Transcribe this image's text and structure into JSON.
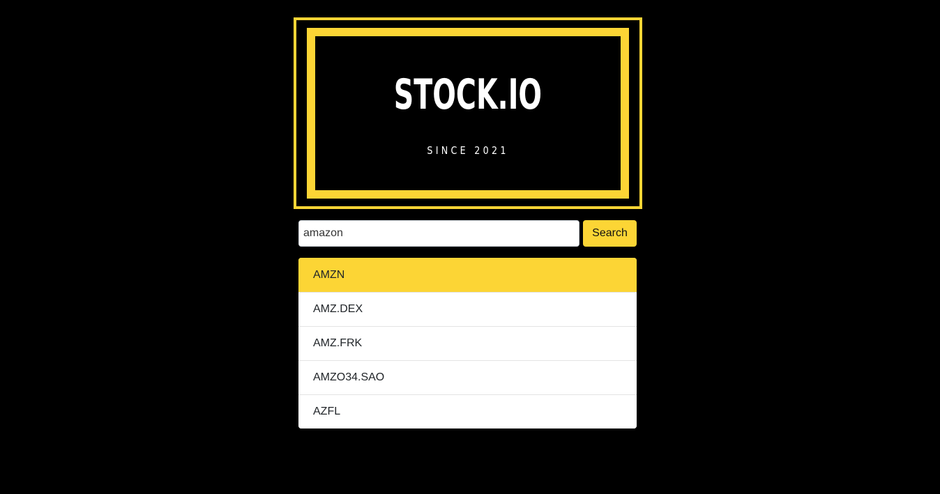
{
  "logo": {
    "title": "STOCK.IO",
    "subtitle": "SINCE 2021"
  },
  "search": {
    "value": "amazon",
    "button_label": "Search"
  },
  "results": [
    {
      "symbol": "AMZN",
      "active": true
    },
    {
      "symbol": "AMZ.DEX",
      "active": false
    },
    {
      "symbol": "AMZ.FRK",
      "active": false
    },
    {
      "symbol": "AMZO34.SAO",
      "active": false
    },
    {
      "symbol": "AZFL",
      "active": false
    }
  ],
  "colors": {
    "accent": "#fcd535",
    "background": "#000000",
    "text_light": "#ffffff"
  }
}
